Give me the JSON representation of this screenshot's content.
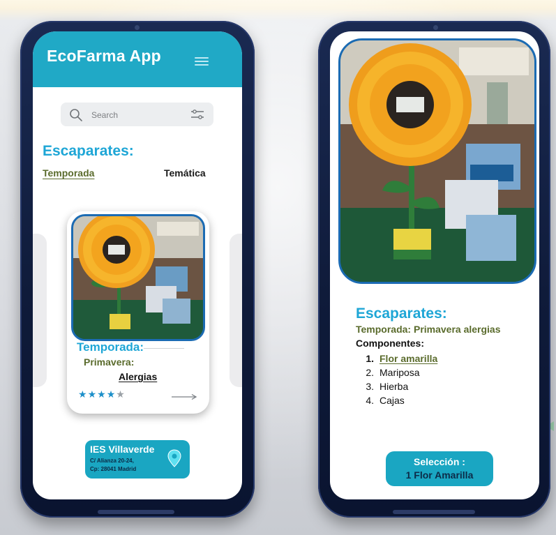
{
  "left_screen": {
    "app_title": "EcoFarma App",
    "search": {
      "placeholder": "Search"
    },
    "section_title": "Escaparates:",
    "tabs": [
      {
        "label": "Temporada",
        "active": true
      },
      {
        "label": "Temática",
        "active": false
      }
    ],
    "card": {
      "title": "Temporada:",
      "subtitle": "Primavera:",
      "name": "Alergias",
      "rating": 4,
      "rating_max": 5
    },
    "location": {
      "name": "IES Villaverde",
      "address_line1": "C/ Alianza 20-24,",
      "address_line2": "Cp: 28041 Madrid"
    }
  },
  "right_screen": {
    "section_title": "Escaparates:",
    "season_line": "Temporada: Primavera alergias",
    "components_label": "Componentes:",
    "components": [
      {
        "num": "1.",
        "label": "Flor amarilla",
        "selected": true
      },
      {
        "num": "2.",
        "label": "Mariposa",
        "selected": false
      },
      {
        "num": "3.",
        "label": "Hierba",
        "selected": false
      },
      {
        "num": "4.",
        "label": "Cajas",
        "selected": false
      }
    ],
    "selection": {
      "label": "Selección :",
      "value": "1 Flor Amarilla"
    }
  },
  "colors": {
    "header": "#20a9c6",
    "accent_text": "#1ea6d6",
    "olive": "#5a6b2c",
    "badge": "#1aa6c2",
    "star_on": "#1c8fc9",
    "star_off": "#9aa0a6",
    "phone_frame": "#0f1b3a"
  },
  "icons": [
    "menu-icon",
    "search-icon",
    "filter-icon",
    "location-pin-icon",
    "arrow-right-icon",
    "star-icon"
  ]
}
